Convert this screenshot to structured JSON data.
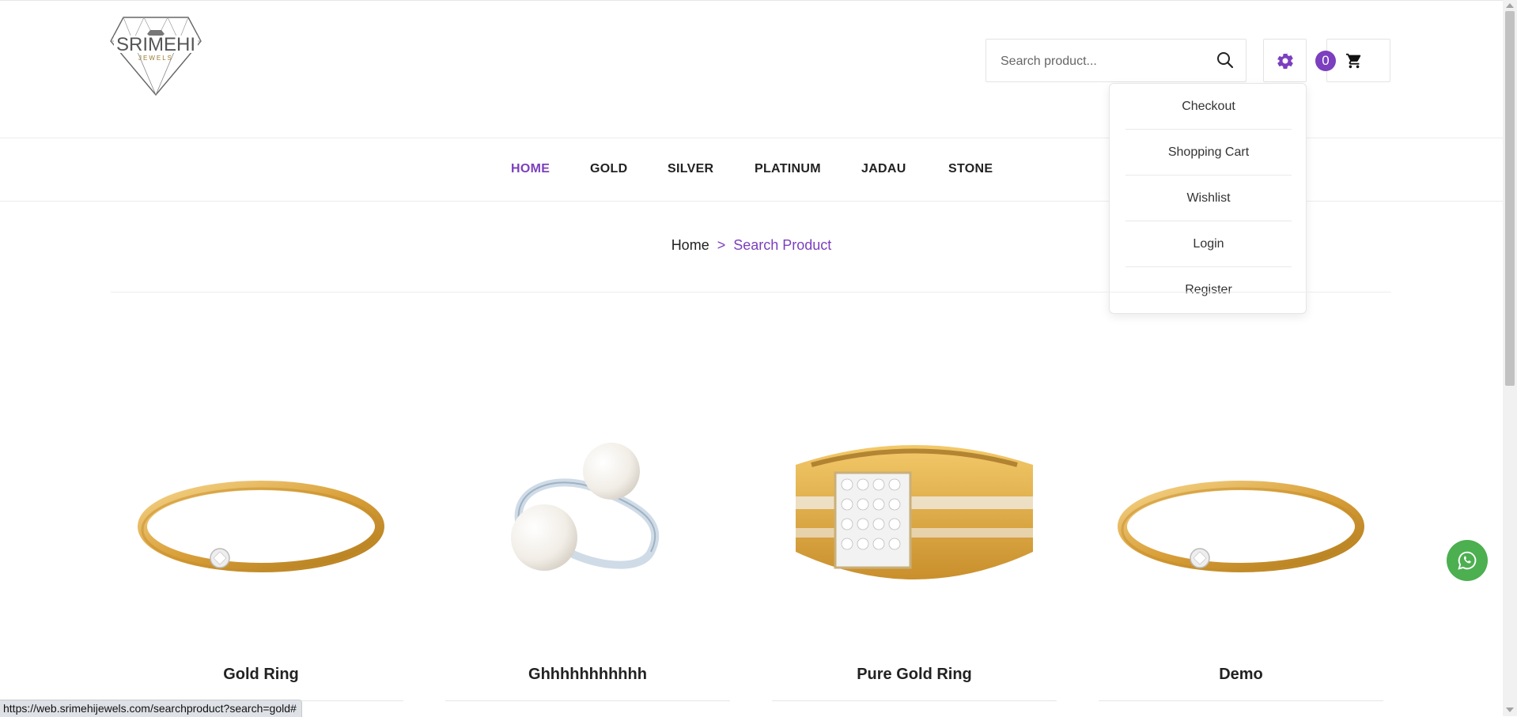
{
  "header": {
    "logo_text": "SRIMEHI",
    "logo_sub": "JEWELS",
    "search": {
      "placeholder": "Search product..."
    },
    "cart_count": "0"
  },
  "dropdown": {
    "items": [
      {
        "label": "Checkout"
      },
      {
        "label": "Shopping Cart"
      },
      {
        "label": "Wishlist"
      },
      {
        "label": "Login"
      },
      {
        "label": "Register"
      }
    ]
  },
  "nav": {
    "items": [
      {
        "label": "HOME",
        "active": true
      },
      {
        "label": "GOLD"
      },
      {
        "label": "SILVER"
      },
      {
        "label": "PLATINUM"
      },
      {
        "label": "JADAU"
      },
      {
        "label": "STONE"
      }
    ]
  },
  "breadcrumb": {
    "home": "Home",
    "separator": ">",
    "current": "Search Product"
  },
  "products": [
    {
      "name": "Gold Ring"
    },
    {
      "name": "Ghhhhhhhhhhh"
    },
    {
      "name": "Pure Gold Ring"
    },
    {
      "name": "Demo"
    }
  ],
  "status_url": "https://web.srimehijewels.com/searchproduct?search=gold#",
  "colors": {
    "accent": "#7b3fbf",
    "whatsapp": "#4caf50",
    "gold": "#e0a93a"
  },
  "icons": [
    "search-icon",
    "gear-icon",
    "cart-icon",
    "whatsapp-icon",
    "diamond-logo"
  ]
}
